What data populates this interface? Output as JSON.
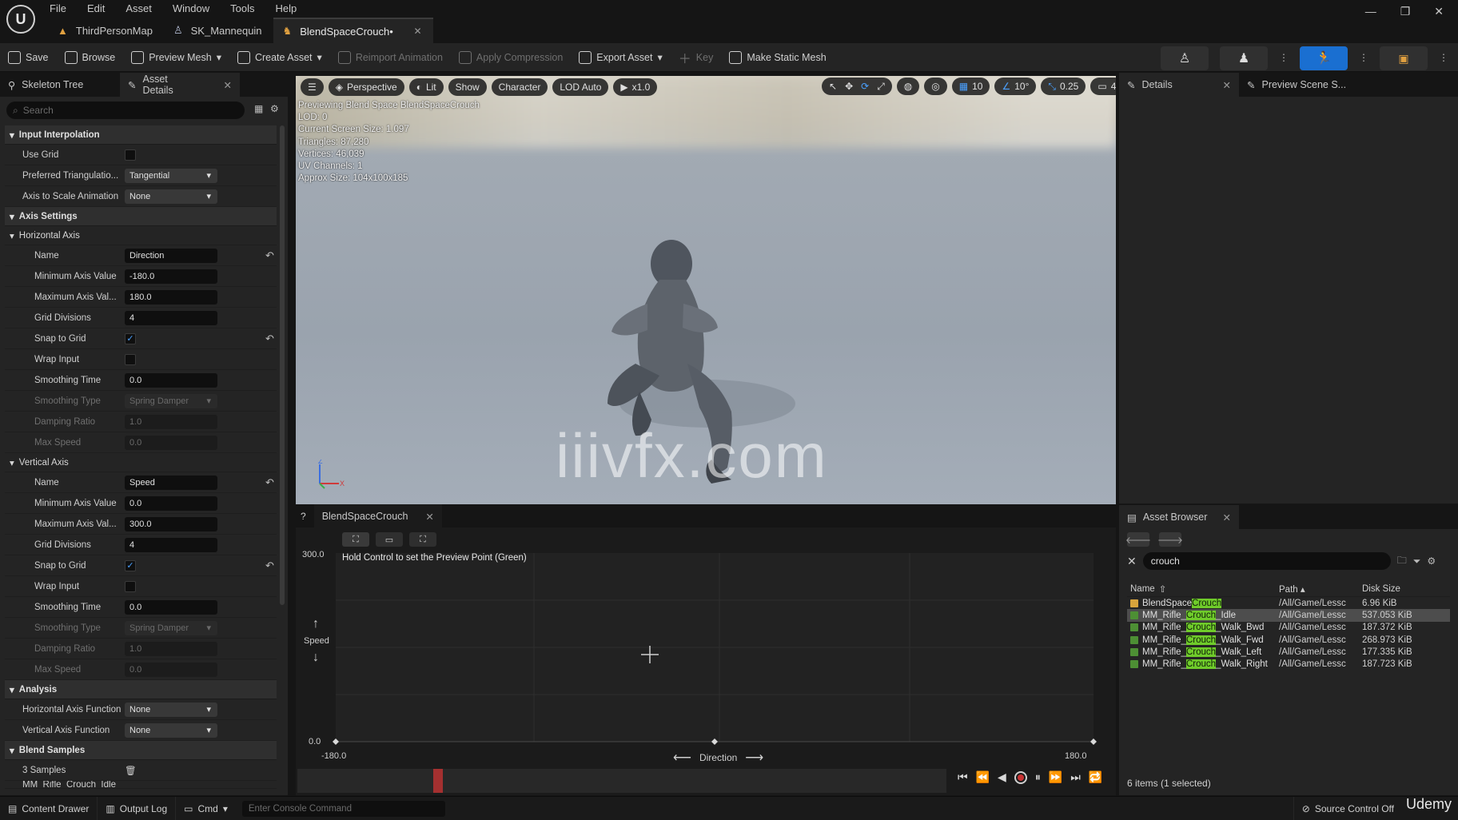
{
  "app": {
    "menu": [
      "File",
      "Edit",
      "Asset",
      "Window",
      "Tools",
      "Help"
    ],
    "tabs": [
      {
        "label": "ThirdPersonMap",
        "icon": "level-icon"
      },
      {
        "label": "SK_Mannequin",
        "icon": "skeletal-mesh-icon"
      },
      {
        "label": "BlendSpaceCrouch•",
        "icon": "blendspace-icon",
        "active": true
      }
    ]
  },
  "toolbar": {
    "save": "Save",
    "browse": "Browse",
    "preview_mesh": "Preview Mesh",
    "create_asset": "Create Asset",
    "reimport": "Reimport Animation",
    "apply_compression": "Apply Compression",
    "export_asset": "Export Asset",
    "key": "Key",
    "make_static_mesh": "Make Static Mesh"
  },
  "left_panel": {
    "tabs": [
      "Skeleton Tree",
      "Asset Details"
    ],
    "search_placeholder": "Search",
    "input_interpolation": {
      "title": "Input Interpolation",
      "use_grid_label": "Use Grid",
      "preferred_triangulation_label": "Preferred Triangulatio...",
      "preferred_triangulation_value": "Tangential",
      "axis_to_scale_label": "Axis to Scale Animation",
      "axis_to_scale_value": "None"
    },
    "axis_settings": {
      "title": "Axis Settings",
      "horizontal": {
        "title": "Horizontal Axis",
        "name_label": "Name",
        "name_value": "Direction",
        "min_label": "Minimum Axis Value",
        "min_value": "-180.0",
        "max_label": "Maximum Axis Val...",
        "max_value": "180.0",
        "grid_label": "Grid Divisions",
        "grid_value": "4",
        "snap_label": "Snap to Grid",
        "wrap_label": "Wrap Input",
        "smoothing_time_label": "Smoothing Time",
        "smoothing_time_value": "0.0",
        "smoothing_type_label": "Smoothing Type",
        "smoothing_type_value": "Spring Damper",
        "damping_label": "Damping Ratio",
        "damping_value": "1.0",
        "max_speed_label": "Max Speed",
        "max_speed_value": "0.0"
      },
      "vertical": {
        "title": "Vertical Axis",
        "name_label": "Name",
        "name_value": "Speed",
        "min_label": "Minimum Axis Value",
        "min_value": "0.0",
        "max_label": "Maximum Axis Val...",
        "max_value": "300.0",
        "grid_label": "Grid Divisions",
        "grid_value": "4",
        "snap_label": "Snap to Grid",
        "wrap_label": "Wrap Input",
        "smoothing_time_label": "Smoothing Time",
        "smoothing_time_value": "0.0",
        "smoothing_type_label": "Smoothing Type",
        "smoothing_type_value": "Spring Damper",
        "damping_label": "Damping Ratio",
        "damping_value": "1.0",
        "max_speed_label": "Max Speed",
        "max_speed_value": "0.0"
      }
    },
    "analysis": {
      "title": "Analysis",
      "h_func_label": "Horizontal Axis Function",
      "h_func_value": "None",
      "v_func_label": "Vertical Axis Function",
      "v_func_value": "None"
    },
    "blend_samples": {
      "title": "Blend Samples",
      "count_label": "3 Samples",
      "first_item": "MM_Rifle_Crouch_Idle"
    }
  },
  "viewport": {
    "perspective": "Perspective",
    "lit": "Lit",
    "show": "Show",
    "character": "Character",
    "lod": "LOD Auto",
    "speed": "x1.0",
    "grid_snap": "10",
    "rot_snap": "10°",
    "scale_snap": "0.25",
    "camera_speed": "4",
    "stats": [
      "Previewing Blend Space BlendSpaceCrouch",
      "LOD: 0",
      "Current Screen Size: 1.097",
      "Triangles: 87,280",
      "Vertices: 46,039",
      "UV Channels: 1",
      "Approx Size: 104x100x185"
    ],
    "watermark": "iiivfx.com"
  },
  "details": {
    "tabs": [
      "Details",
      "Preview Scene S..."
    ]
  },
  "blendspace": {
    "tab": "BlendSpaceCrouch",
    "hint": "Hold Control to set the Preview Point (Green)",
    "y_max": "300.0",
    "y_min": "0.0",
    "x_min": "-180.0",
    "x_max": "180.0",
    "x_axis_name": "Direction",
    "y_axis_name": "Speed"
  },
  "asset_browser": {
    "tab": "Asset Browser",
    "search_value": "crouch",
    "columns": {
      "name": "Name",
      "path": "Path",
      "size": "Disk Size"
    },
    "rows": [
      {
        "pre": "BlendSpace",
        "hl": "Crouch",
        "post": "",
        "path": "/All/Game/Lessc",
        "size": "6.96 KiB",
        "type": "blendspace"
      },
      {
        "pre": "MM_Rifle_",
        "hl": "Crouch",
        "post": "_Idle",
        "path": "/All/Game/Lessc",
        "size": "537.053 KiB",
        "type": "anim",
        "selected": true
      },
      {
        "pre": "MM_Rifle_",
        "hl": "Crouch",
        "post": "_Walk_Bwd",
        "path": "/All/Game/Lessc",
        "size": "187.372 KiB",
        "type": "anim"
      },
      {
        "pre": "MM_Rifle_",
        "hl": "Crouch",
        "post": "_Walk_Fwd",
        "path": "/All/Game/Lessc",
        "size": "268.973 KiB",
        "type": "anim"
      },
      {
        "pre": "MM_Rifle_",
        "hl": "Crouch",
        "post": "_Walk_Left",
        "path": "/All/Game/Lessc",
        "size": "177.335 KiB",
        "type": "anim"
      },
      {
        "pre": "MM_Rifle_",
        "hl": "Crouch",
        "post": "_Walk_Right",
        "path": "/All/Game/Lessc",
        "size": "187.723 KiB",
        "type": "anim"
      }
    ],
    "footer": "6 items (1 selected)"
  },
  "statusbar": {
    "content_drawer": "Content Drawer",
    "output_log": "Output Log",
    "cmd": "Cmd",
    "console_placeholder": "Enter Console Command",
    "source_control": "Source Control Off"
  },
  "overlay": {
    "udemy": "Udemy"
  },
  "colors": {
    "accent": "#1a6fd1",
    "highlight": "#6fcb2a",
    "playhead": "#a43030"
  }
}
